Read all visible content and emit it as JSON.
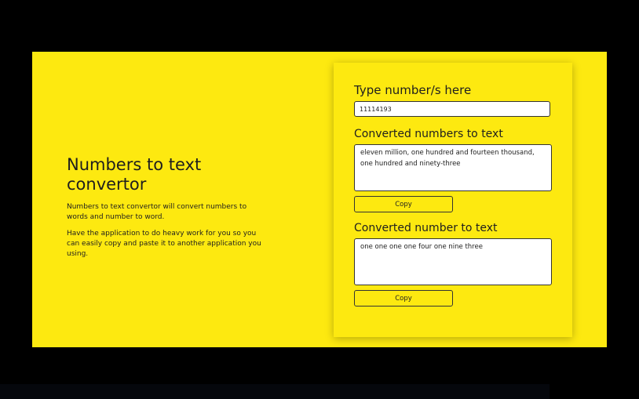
{
  "intro": {
    "title": "Numbers to text convertor",
    "paragraph1": "Numbers to text convertor will convert numbers to words and number to word.",
    "paragraph2": "Have the application to do heavy work for you so you can easily copy and paste it to another application you using."
  },
  "form": {
    "input_label": "Type number/s here",
    "input_value": "11114193",
    "numbers_label": "Converted numbers to text",
    "numbers_output": "eleven million, one hundred and fourteen thousand, one hundred and ninety-three",
    "copy_label_1": "Copy",
    "digits_label": "Converted number to text",
    "digits_output": "one one one one four one nine three",
    "copy_label_2": "Copy"
  },
  "colors": {
    "background": "#fde910",
    "frame": "#000000",
    "text": "#1e1e1e"
  }
}
